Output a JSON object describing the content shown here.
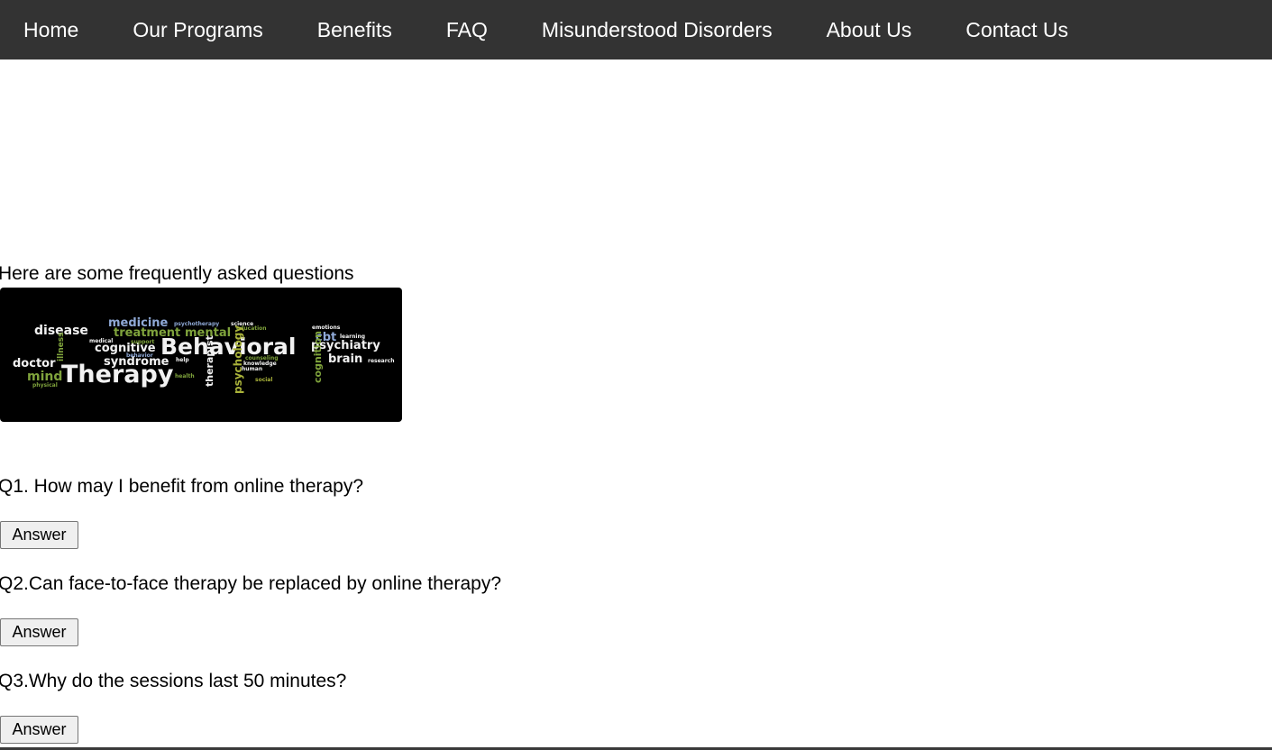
{
  "nav": {
    "items": [
      {
        "label": "Home"
      },
      {
        "label": "Our Programs"
      },
      {
        "label": "Benefits"
      },
      {
        "label": "FAQ"
      },
      {
        "label": "Misunderstood Disorders"
      },
      {
        "label": "About Us"
      },
      {
        "label": "Contact Us"
      }
    ]
  },
  "faq": {
    "intro": "Here are some frequently asked questions",
    "image": {
      "words": {
        "main1": "Behavioral",
        "main2": "Therapy",
        "w_disease": "disease",
        "w_medicine": "medicine",
        "w_psychotherapy": "psychotherapy",
        "w_science": "science",
        "w_treatment": "treatment",
        "w_mental": "mental",
        "w_cognitive": "cognitive",
        "w_psychiatry": "psychiatry",
        "w_doctor": "doctor",
        "w_mind": "mind",
        "w_syndrome": "syndrome",
        "w_brain": "brain",
        "w_cbt": "cbt",
        "w_emotions": "emotions",
        "w_learning": "learning",
        "w_therapist": "therapist",
        "w_psychology": "psychology",
        "w_cognition": "cognition",
        "w_medical": "medical",
        "w_support": "support",
        "w_health": "health",
        "w_research": "research",
        "w_counseling": "counseling",
        "w_knowledge": "knowledge",
        "w_human": "human",
        "w_social": "social",
        "w_physical": "physical",
        "w_education": "education",
        "w_help": "help",
        "w_illness": "illness",
        "w_behavior": "behavior"
      },
      "colors": {
        "background": "#000000",
        "white": "#f2f2f2",
        "green": "#7fa33c",
        "blue": "#8fa9d6",
        "olive": "#a9b23a"
      }
    },
    "questions": [
      {
        "text": "Q1. How may I benefit from online therapy?",
        "button": "Answer"
      },
      {
        "text": "Q2.Can face-to-face therapy be replaced by online therapy?",
        "button": "Answer"
      },
      {
        "text": "Q3.Why do the sessions last 50 minutes?",
        "button": "Answer"
      }
    ]
  },
  "colors": {
    "navbar_bg": "#333333",
    "nav_text": "#ffffff",
    "button_bg": "#efefef"
  }
}
